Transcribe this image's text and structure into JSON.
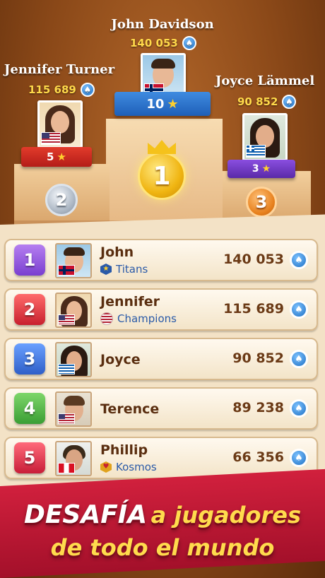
{
  "podium": {
    "first": {
      "name": "John Davidson",
      "score": "140 053",
      "level": "10"
    },
    "second": {
      "name": "Jennifer Turner",
      "score": "115 689",
      "level": "5"
    },
    "third": {
      "name": "Joyce Lämmel",
      "score": "90 852",
      "level": "3"
    },
    "medal_first": "1",
    "medal_second": "2",
    "medal_third": "3"
  },
  "leaderboard": [
    {
      "rank": "1",
      "name": "John",
      "team": "Titans",
      "score": "140 053"
    },
    {
      "rank": "2",
      "name": "Jennifer",
      "team": "Champions",
      "score": "115 689"
    },
    {
      "rank": "3",
      "name": "Joyce",
      "team": "",
      "score": "90 852"
    },
    {
      "rank": "4",
      "name": "Terence",
      "team": "",
      "score": "89 238"
    },
    {
      "rank": "5",
      "name": "Phillip",
      "team": "Kosmos",
      "score": "66 356"
    }
  ],
  "banner": {
    "line1_a": "DESAFÍA",
    "line1_b": "a jugadores",
    "line2": "de todo el mundo"
  },
  "colors": {
    "banner": "#c8183a",
    "rank1": "#9b5de5",
    "rank2": "#e0404a",
    "rank3": "#4a7fd6",
    "rank4": "#4cb84a",
    "rank5": "#d9334b"
  }
}
